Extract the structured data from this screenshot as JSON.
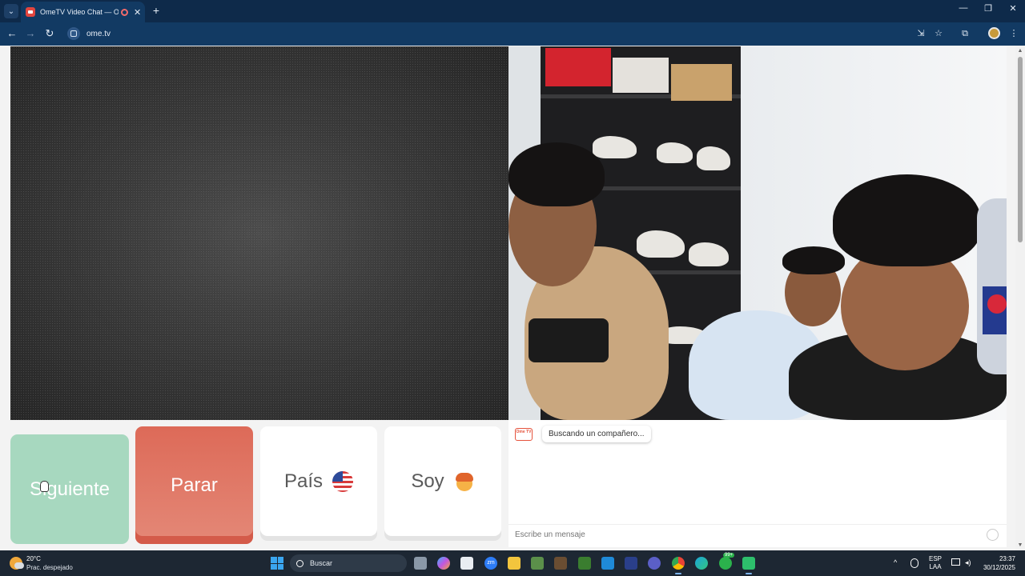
{
  "browser": {
    "tab_title": "OmeTV Video Chat — Ome",
    "tab_close": "✕",
    "new_tab": "+",
    "tab_menu": "⌄",
    "url": "ome.tv",
    "window_controls": {
      "minimize": "—",
      "restore": "❐",
      "close": "✕"
    },
    "toolbar_icons": {
      "back": "←",
      "forward": "→",
      "reload": "↻",
      "install": "⇲",
      "bookmark": "☆",
      "extensions": "⧉",
      "menu": "⋮"
    }
  },
  "controls": {
    "next_label": "Siguiente",
    "stop_label": "Parar",
    "country_label": "País",
    "gender_label": "Soy"
  },
  "chat": {
    "logo_text": "Ome TV",
    "status_message": "Buscando un compañero...",
    "input_placeholder": "Escribe un mensaje"
  },
  "taskbar": {
    "temperature": "20°C",
    "weather": "Prac. despejado",
    "search_placeholder": "Buscar",
    "zoom_label": "zm",
    "whatsapp_badge": "99+",
    "language_line1": "ESP",
    "language_line2": "LAA",
    "time": "23:37",
    "date": "30/12/2025",
    "chevron": "^"
  },
  "colors": {
    "next_button": "#a7d8bf",
    "stop_button": "#dd6a58",
    "browser_frame": "#0e2a4a",
    "taskbar": "#1d2733"
  }
}
